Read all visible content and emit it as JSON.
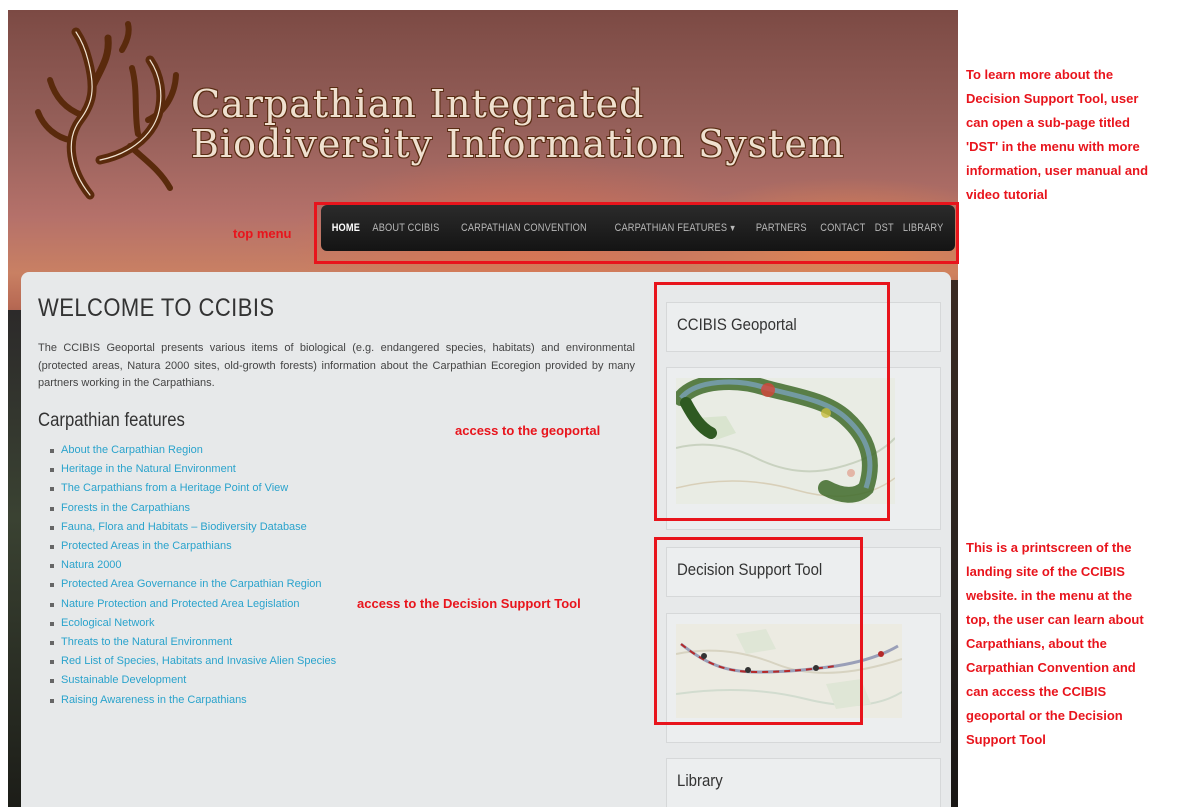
{
  "site": {
    "title_line1": "Carpathian Integrated",
    "title_line2": "Biodiversity Information System"
  },
  "nav": {
    "items": [
      {
        "label": "HOME",
        "active": true
      },
      {
        "label": "ABOUT CCIBIS"
      },
      {
        "label": "CARPATHIAN CONVENTION"
      },
      {
        "label": "CARPATHIAN FEATURES",
        "icon": "caret-down-icon"
      },
      {
        "label": "PARTNERS"
      },
      {
        "label": "CONTACT"
      },
      {
        "label": "DST"
      },
      {
        "label": "LIBRARY"
      }
    ]
  },
  "main": {
    "title": "WELCOME TO CCIBIS",
    "intro": "The CCIBIS Geoportal presents various items of biological (e.g. endangered species, habitats) and environmental (protected areas, Natura 2000 sites, old-growth forests) information about the Carpathian Ecoregion provided by many partners working in the Carpathians.",
    "section_heading": "Carpathian features",
    "features": [
      "About the Carpathian Region",
      "Heritage in the Natural Environment",
      "The Carpathians from a Heritage Point of View",
      "Forests in the Carpathians",
      "Fauna, Flora and Habitats – Biodiversity Database",
      "Protected Areas in the Carpathians",
      "Natura 2000",
      "Protected Area Governance in the Carpathian Region",
      "Nature Protection and Protected Area Legislation",
      "Ecological Network",
      "Threats to the Natural Environment",
      "Red List of Species, Habitats and Invasive Alien Species",
      "Sustainable Development",
      "Raising Awareness in the Carpathians"
    ]
  },
  "sidebar": {
    "geoportal_title": "CCIBIS Geoportal",
    "dst_title": "Decision Support Tool",
    "library_title": "Library"
  },
  "annotations": {
    "top_menu": "top menu",
    "geoportal": "access to the geoportal",
    "dst": "access to the Decision Support Tool",
    "top_right_note": [
      "To learn more about the",
      "Decision Support Tool, user",
      "can open a sub-page titled",
      "'DST' in the menu with more",
      "information, user manual and",
      "video tutorial"
    ],
    "bottom_right_note": [
      "This is a printscreen of the",
      "landing site of the CCIBIS",
      "website. in the menu at the",
      "top, the user can learn about",
      "Carpathians, about the",
      "Carpathian Convention and",
      "can access the CCIBIS",
      "geoportal or the Decision",
      "Support Tool"
    ]
  },
  "colors": {
    "annotation_red": "#e8141c",
    "link_blue": "#2aa3cc",
    "nav_bg": "#1c1c1c",
    "panel_bg": "#e7e9ea"
  }
}
